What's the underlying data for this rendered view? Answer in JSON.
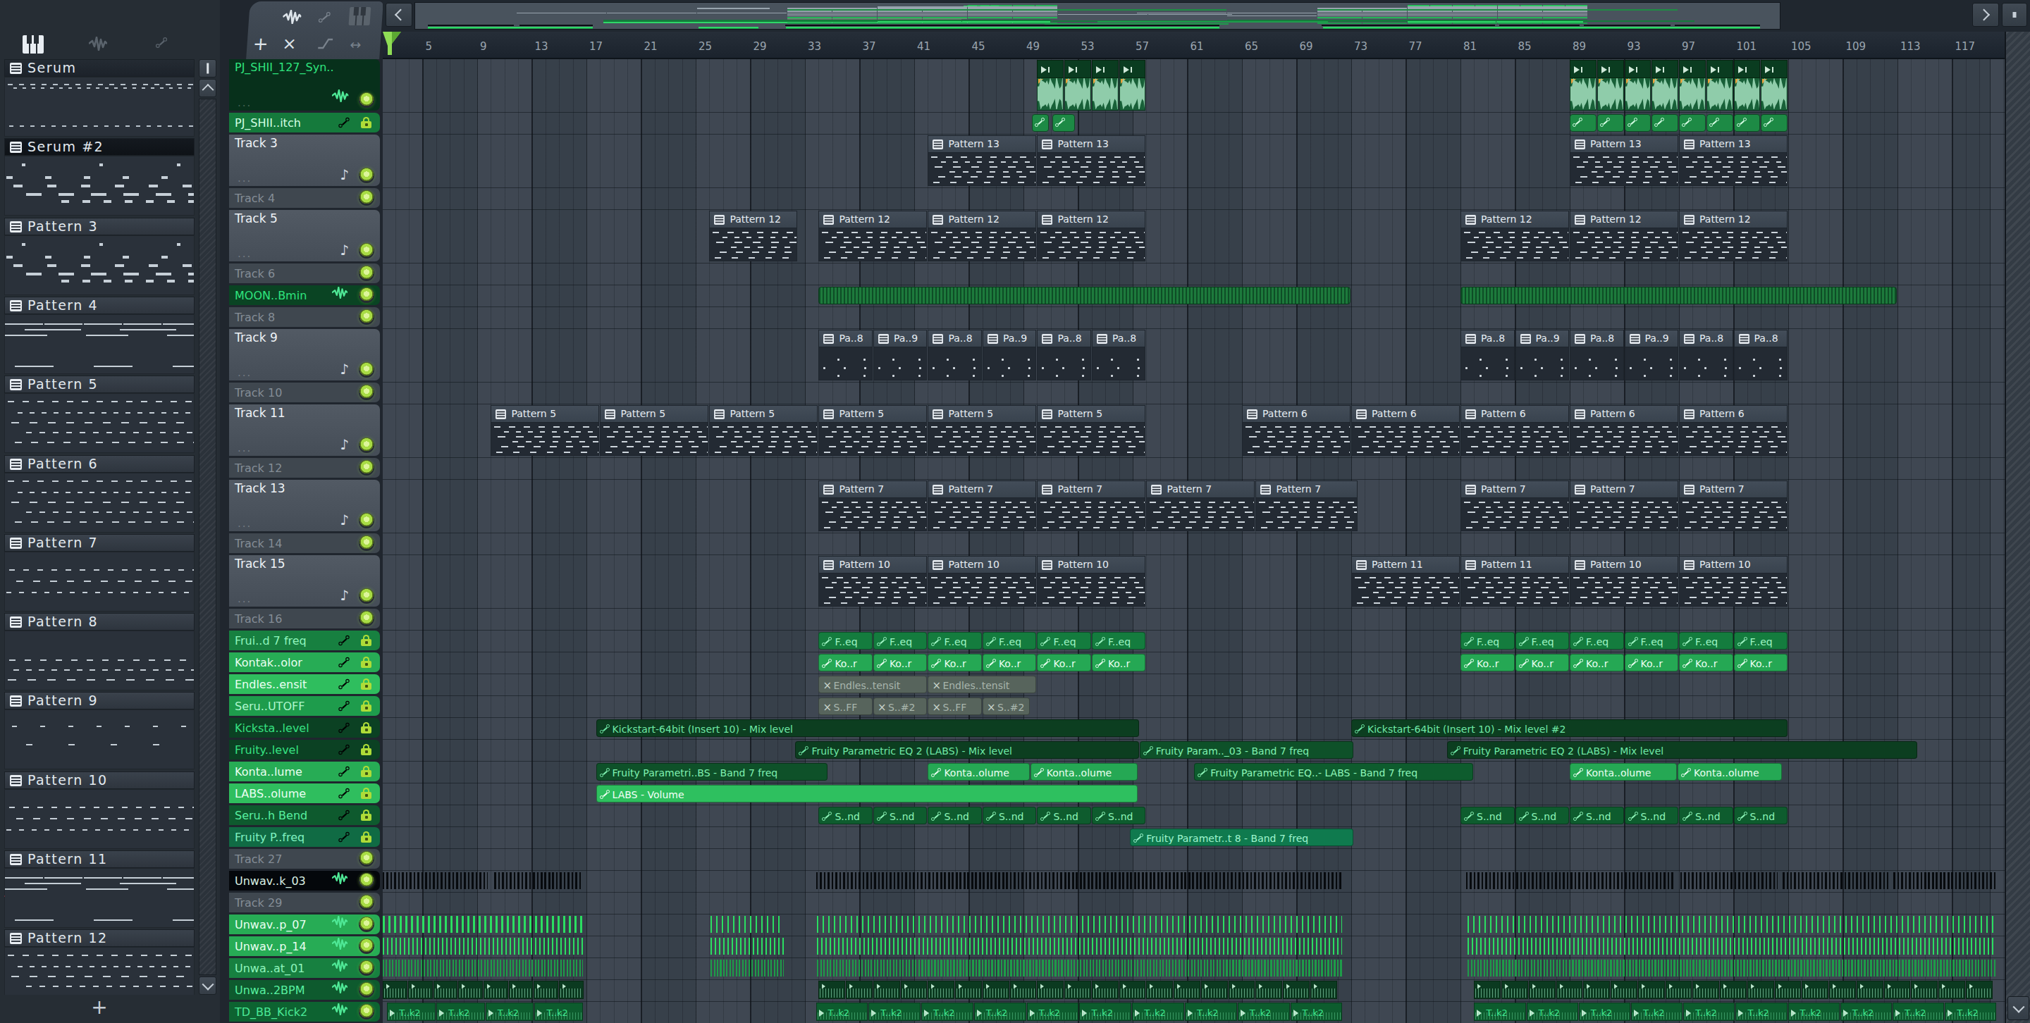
{
  "picker": {
    "tabs": [
      {
        "icon": "piano-icon",
        "active": true
      },
      {
        "icon": "wave-icon",
        "active": false
      },
      {
        "icon": "automation-icon",
        "active": false
      }
    ],
    "patterns": [
      {
        "name": "Serum",
        "thumb": "sparse2",
        "header": "dark"
      },
      {
        "name": "Serum #2",
        "thumb": "drums",
        "header": "darkest"
      },
      {
        "name": "Pattern 3",
        "thumb": "drums",
        "header": "normal"
      },
      {
        "name": "Pattern 4",
        "thumb": "lines",
        "header": "normal"
      },
      {
        "name": "Pattern 5",
        "thumb": "melody",
        "header": "normal"
      },
      {
        "name": "Pattern 6",
        "thumb": "melody",
        "header": "normal"
      },
      {
        "name": "Pattern 7",
        "thumb": "melody2",
        "header": "normal"
      },
      {
        "name": "Pattern 8",
        "thumb": "melody3",
        "header": "normal"
      },
      {
        "name": "Pattern 9",
        "thumb": "sparse",
        "header": "normal"
      },
      {
        "name": "Pattern 10",
        "thumb": "melody2",
        "header": "normal"
      },
      {
        "name": "Pattern 11",
        "thumb": "lines",
        "header": "normal",
        "marker": true
      },
      {
        "name": "Pattern 12",
        "thumb": "melody",
        "header": "normal"
      }
    ],
    "add_label": "+"
  },
  "toolbar": {
    "add_label": "+",
    "icons": [
      "wave-icon",
      "link-icon",
      "piano-icon",
      "close-icon",
      "slide-icon",
      "swap-icon"
    ]
  },
  "ruler": {
    "first_label": 5,
    "step": 4,
    "last_label": 117
  },
  "tracks": [
    {
      "name": "PJ_SHII_127_Syn..",
      "style": "audioDark",
      "tall": true,
      "icon": "wave",
      "led": true,
      "dots": "..."
    },
    {
      "name": "PJ_SHII..itch",
      "style": "autoMed",
      "icon": "link",
      "lock": true
    },
    {
      "name": "Track 3",
      "style": "grayTall",
      "tall": true,
      "icon": "note",
      "led": true,
      "dots": "..."
    },
    {
      "name": "Track 4",
      "style": "grayDim",
      "led": true
    },
    {
      "name": "Track 5",
      "style": "grayTall",
      "tall": true,
      "icon": "note",
      "led": true,
      "dots": "..."
    },
    {
      "name": "Track 6",
      "style": "grayDim",
      "led": true
    },
    {
      "name": "MOON..Bmin",
      "style": "audioDark2",
      "icon": "wave",
      "led": true
    },
    {
      "name": "Track 8",
      "style": "grayDim",
      "led": true
    },
    {
      "name": "Track 9",
      "style": "grayTall",
      "tall": true,
      "icon": "note",
      "led": true,
      "dots": "..."
    },
    {
      "name": "Track 10",
      "style": "grayDim",
      "led": true
    },
    {
      "name": "Track 11",
      "style": "grayTall",
      "tall": true,
      "icon": "note",
      "led": true,
      "dots": "..."
    },
    {
      "name": "Track 12",
      "style": "grayDim",
      "led": true
    },
    {
      "name": "Track 13",
      "style": "grayTall",
      "tall": true,
      "icon": "note",
      "led": true,
      "dots": "..."
    },
    {
      "name": "Track 14",
      "style": "grayDim",
      "led": true
    },
    {
      "name": "Track 15",
      "style": "grayTall",
      "tall": true,
      "icon": "note",
      "led": true,
      "dots": "..."
    },
    {
      "name": "Track 16",
      "style": "grayDim",
      "led": true
    },
    {
      "name": "Frui..d 7 freq",
      "style": "g3",
      "icon": "link",
      "lock": true
    },
    {
      "name": "Kontak..olor",
      "style": "g4",
      "icon": "link",
      "lock": true
    },
    {
      "name": "Endles..ensit",
      "style": "g4b",
      "icon": "link",
      "lock": true
    },
    {
      "name": "Seru..UTOFF",
      "style": "g3b",
      "icon": "link",
      "lock": true
    },
    {
      "name": "Kicksta..level",
      "style": "g1",
      "icon": "link",
      "lock": true
    },
    {
      "name": "Fruity..level",
      "style": "g1",
      "icon": "link",
      "lock": true
    },
    {
      "name": "Konta..lume",
      "style": "g4",
      "icon": "link",
      "lock": true
    },
    {
      "name": "LABS..olume",
      "style": "g4b",
      "icon": "link",
      "lock": true
    },
    {
      "name": "Seru..h Bend",
      "style": "g2",
      "icon": "link",
      "lock": true
    },
    {
      "name": "Fruity P..freq",
      "style": "gteal",
      "icon": "link",
      "lock": true
    },
    {
      "name": "Track 27",
      "style": "grayDim",
      "led": true
    },
    {
      "name": "Unwav..k_03",
      "style": "black",
      "icon": "wave",
      "led": true
    },
    {
      "name": "Track 29",
      "style": "grayDim",
      "led": true
    },
    {
      "name": "Unwav..p_07",
      "style": "g4",
      "icon": "wave",
      "led": true
    },
    {
      "name": "Unwav..p_14",
      "style": "g4",
      "icon": "wave",
      "led": true
    },
    {
      "name": "Unwa..at_01",
      "style": "g3",
      "icon": "wave",
      "led": true
    },
    {
      "name": "Unwa..2BPM",
      "style": "g2",
      "icon": "wave",
      "led": true
    },
    {
      "name": "TD_BB_Kick2",
      "style": "g2b",
      "icon": "wave",
      "led": true
    }
  ],
  "clips": [
    {
      "t": 0,
      "k": "audio",
      "b": 50,
      "l": 2,
      "n": 4
    },
    {
      "t": 0,
      "k": "audio",
      "b": 89,
      "l": 2,
      "n": 8
    },
    {
      "t": 1,
      "k": "autoicon",
      "b": 49.6,
      "l": 1.3
    },
    {
      "t": 1,
      "k": "autoicon",
      "b": 51.1,
      "l": 1.7
    },
    {
      "t": 1,
      "k": "autoicon",
      "b": 89,
      "l": 2,
      "n": 8
    },
    {
      "t": 2,
      "k": "pattern",
      "txt": "Pattern 13",
      "b": 42,
      "l": 8,
      "n": 2
    },
    {
      "t": 2,
      "k": "pattern",
      "txt": "Pattern 13",
      "b": 89,
      "l": 8,
      "n": 2
    },
    {
      "t": 4,
      "k": "pattern",
      "txt": "Pattern 12",
      "b": 26,
      "l": 6.5
    },
    {
      "t": 4,
      "k": "pattern",
      "txt": "Pattern 12",
      "b": 34,
      "l": 8,
      "n": 3
    },
    {
      "t": 4,
      "k": "pattern",
      "txt": "Pattern 12",
      "b": 81,
      "l": 8,
      "n": 3
    },
    {
      "t": 6,
      "k": "moon",
      "b": 34,
      "l": 39
    },
    {
      "t": 6,
      "k": "moon",
      "b": 81,
      "l": 32
    },
    {
      "t": 8,
      "k": "drum",
      "txt": "Pa..8",
      "b": 34,
      "l": 4
    },
    {
      "t": 8,
      "k": "drum",
      "txt": "Pa..9",
      "b": 38,
      "l": 4
    },
    {
      "t": 8,
      "k": "drum",
      "txt": "Pa..8",
      "b": 42,
      "l": 4
    },
    {
      "t": 8,
      "k": "drum",
      "txt": "Pa..9",
      "b": 46,
      "l": 4
    },
    {
      "t": 8,
      "k": "drum",
      "txt": "Pa..8",
      "b": 50,
      "l": 4
    },
    {
      "t": 8,
      "k": "drum",
      "txt": "Pa..8",
      "b": 54,
      "l": 4
    },
    {
      "t": 8,
      "k": "drum",
      "txt": "Pa..8",
      "b": 81,
      "l": 4
    },
    {
      "t": 8,
      "k": "drum",
      "txt": "Pa..9",
      "b": 85,
      "l": 4
    },
    {
      "t": 8,
      "k": "drum",
      "txt": "Pa..8",
      "b": 89,
      "l": 4
    },
    {
      "t": 8,
      "k": "drum",
      "txt": "Pa..9",
      "b": 93,
      "l": 4
    },
    {
      "t": 8,
      "k": "drum",
      "txt": "Pa..8",
      "b": 97,
      "l": 4
    },
    {
      "t": 8,
      "k": "drum",
      "txt": "Pa..8",
      "b": 101,
      "l": 4
    },
    {
      "t": 10,
      "k": "pattern",
      "txt": "Pattern 5",
      "b": 10,
      "l": 8,
      "n": 6
    },
    {
      "t": 10,
      "k": "pattern",
      "txt": "Pattern 6",
      "b": 65,
      "l": 8,
      "n": 5
    },
    {
      "t": 12,
      "k": "pattern",
      "txt": "Pattern 7",
      "b": 34,
      "l": 8,
      "n": 4
    },
    {
      "t": 12,
      "k": "pattern",
      "txt": "Pattern 7",
      "b": 66,
      "l": 7.5
    },
    {
      "t": 12,
      "k": "pattern",
      "txt": "Pattern 7",
      "b": 81,
      "l": 8,
      "n": 3
    },
    {
      "t": 14,
      "k": "pattern",
      "txt": "Pattern 10",
      "b": 34,
      "l": 8,
      "n": 3
    },
    {
      "t": 14,
      "k": "pattern",
      "txt": "Pattern 11",
      "b": 73,
      "l": 8,
      "n": 2
    },
    {
      "t": 14,
      "k": "pattern",
      "txt": "Pattern 10",
      "b": 89,
      "l": 8,
      "n": 2
    },
    {
      "t": 16,
      "k": "auto",
      "c": "m2",
      "txt": "F..eq",
      "b": 34,
      "l": 4,
      "n": 6
    },
    {
      "t": 16,
      "k": "auto",
      "c": "m2",
      "txt": "F..eq",
      "b": 81,
      "l": 4,
      "n": 6
    },
    {
      "t": 17,
      "k": "auto",
      "c": "b1",
      "txt": "Ko..r",
      "b": 34,
      "l": 4,
      "n": 6
    },
    {
      "t": 17,
      "k": "auto",
      "c": "b1",
      "txt": "Ko..r",
      "b": 81,
      "l": 4,
      "n": 6
    },
    {
      "t": 18,
      "k": "muted",
      "txt": "Endles..tensit",
      "b": 34,
      "l": 8,
      "n": 2
    },
    {
      "t": 19,
      "k": "muted",
      "txt": "S..FF",
      "b": 34,
      "l": 4
    },
    {
      "t": 19,
      "k": "muted",
      "txt": "S..#2",
      "b": 38,
      "l": 4
    },
    {
      "t": 19,
      "k": "muted",
      "txt": "S..FF",
      "b": 42,
      "l": 4
    },
    {
      "t": 19,
      "k": "muted",
      "txt": "S..#2",
      "b": 46,
      "l": 3.5
    },
    {
      "t": 20,
      "k": "auto",
      "c": "d1",
      "txt": "Kickstart-64bit (Insert 10) - Mix level",
      "b": 17.7,
      "l": 39.8
    },
    {
      "t": 20,
      "k": "auto",
      "c": "d1",
      "txt": "Kickstart-64bit (Insert 10) - Mix level #2",
      "b": 73,
      "l": 32
    },
    {
      "t": 21,
      "k": "auto",
      "c": "d1",
      "txt": "Fruity Parametric EQ 2 (LABS) - Mix level",
      "b": 32.3,
      "l": 25.2
    },
    {
      "t": 21,
      "k": "auto",
      "c": "d2",
      "txt": "Fruity Param.._03 - Band 7 freq",
      "b": 57.5,
      "l": 15.7
    },
    {
      "t": 21,
      "k": "auto",
      "c": "d1",
      "txt": "Fruity Parametric EQ 2 (LABS) - Mix level",
      "b": 80,
      "l": 34.5
    },
    {
      "t": 22,
      "k": "auto",
      "c": "d2",
      "txt": "Fruity Parametri..BS - Band 7 freq",
      "b": 17.7,
      "l": 17
    },
    {
      "t": 22,
      "k": "auto",
      "c": "b1",
      "txt": "Konta..olume",
      "b": 42,
      "l": 7.5
    },
    {
      "t": 22,
      "k": "auto",
      "c": "b1",
      "txt": "Konta..olume",
      "b": 49.5,
      "l": 7.9
    },
    {
      "t": 22,
      "k": "auto",
      "c": "m1",
      "txt": "Fruity Parametric EQ..- LABS - Band 7 freq",
      "b": 61.5,
      "l": 20.5
    },
    {
      "t": 22,
      "k": "auto",
      "c": "b1",
      "txt": "Konta..olume",
      "b": 89,
      "l": 7.9
    },
    {
      "t": 22,
      "k": "auto",
      "c": "b1",
      "txt": "Konta..olume",
      "b": 96.9,
      "l": 7.7
    },
    {
      "t": 23,
      "k": "auto",
      "c": "b2",
      "txt": "LABS - Volume",
      "b": 17.7,
      "l": 39.7
    },
    {
      "t": 24,
      "k": "auto",
      "c": "m1",
      "txt": "S..nd",
      "b": 34,
      "l": 4,
      "n": 6
    },
    {
      "t": 24,
      "k": "auto",
      "c": "m1",
      "txt": "S..nd",
      "b": 81,
      "l": 4,
      "n": 6
    },
    {
      "t": 25,
      "k": "auto",
      "c": "t1",
      "txt": "Fruity Parametr..t 8 - Band 7 freq",
      "b": 56.8,
      "l": 16.4
    },
    {
      "t": 27,
      "k": "blackstripe",
      "b": 2.1,
      "l": 7.7
    },
    {
      "t": 27,
      "k": "blackstripe",
      "b": 10.25,
      "l": 6.55
    },
    {
      "t": 27,
      "k": "blackstripe",
      "b": 33.8,
      "l": 38.6
    },
    {
      "t": 27,
      "k": "blackstripe",
      "b": 81.4,
      "l": 15.4
    },
    {
      "t": 27,
      "k": "blackstripe",
      "b": 97.1,
      "l": 7.2
    },
    {
      "t": 27,
      "k": "blackstripe",
      "b": 104.6,
      "l": 7.8
    },
    {
      "t": 27,
      "k": "blackstripe",
      "b": 112.7,
      "l": 7.6
    },
    {
      "t": 29,
      "k": "stripeA",
      "b": 2.1,
      "l": 14.7
    },
    {
      "t": 29,
      "k": "stripeA",
      "b": 26.1,
      "l": 5.4
    },
    {
      "t": 29,
      "k": "stripeA",
      "b": 33.9,
      "l": 38.5
    },
    {
      "t": 29,
      "k": "stripeA",
      "b": 81.5,
      "l": 38.8
    },
    {
      "t": 30,
      "k": "stripeB",
      "b": 2.1,
      "l": 14.7
    },
    {
      "t": 30,
      "k": "stripeB",
      "b": 26.1,
      "l": 5.4
    },
    {
      "t": 30,
      "k": "stripeB",
      "b": 33.9,
      "l": 38.5
    },
    {
      "t": 30,
      "k": "stripeB",
      "b": 81.5,
      "l": 38.8
    },
    {
      "t": 31,
      "k": "stripeC",
      "b": 2.1,
      "l": 14.7
    },
    {
      "t": 31,
      "k": "stripeC",
      "b": 26.1,
      "l": 5.4
    },
    {
      "t": 31,
      "k": "stripeC",
      "b": 33.9,
      "l": 38.5
    },
    {
      "t": 31,
      "k": "stripeC",
      "b": 81.5,
      "l": 38.8
    },
    {
      "t": 32,
      "k": "wavemini",
      "b": 2.1,
      "l": 1.84,
      "n": 8
    },
    {
      "t": 32,
      "k": "wavemini",
      "b": 34,
      "l": 2,
      "n": 19
    },
    {
      "t": 32,
      "k": "wavemini",
      "b": 82,
      "l": 2,
      "n": 19
    },
    {
      "t": 33,
      "k": "kick",
      "txt": "T..k2",
      "b": 2.4,
      "l": 3.6,
      "n": 4
    },
    {
      "t": 33,
      "k": "kick",
      "txt": "T..k2",
      "b": 33.8,
      "l": 3.86,
      "n": 10
    },
    {
      "t": 33,
      "k": "kick",
      "txt": "T..k2",
      "b": 82,
      "l": 3.83,
      "n": 10
    }
  ]
}
